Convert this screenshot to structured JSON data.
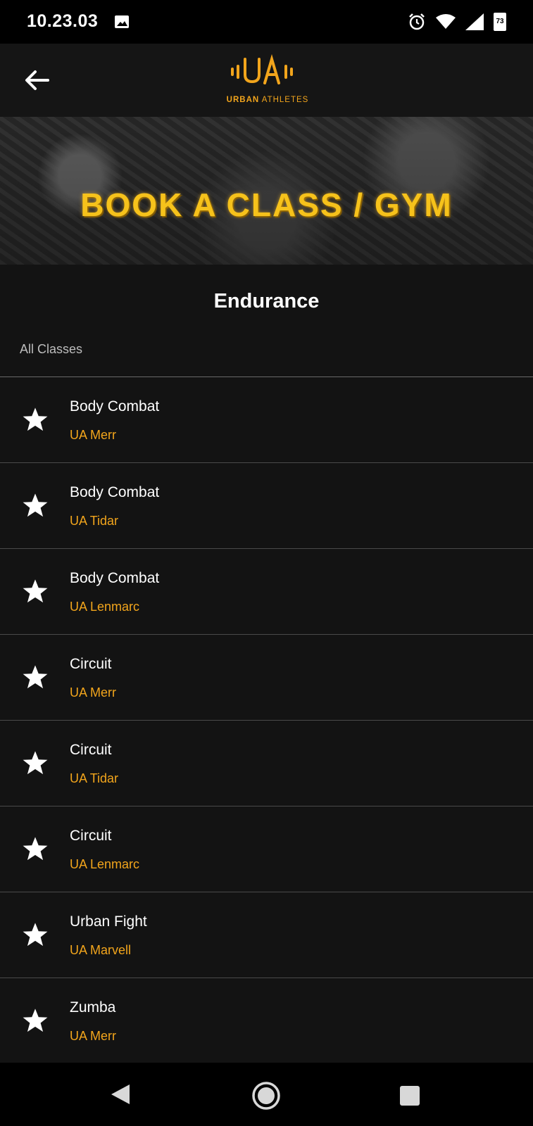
{
  "status_bar": {
    "time": "10.23.03",
    "battery": "73"
  },
  "header": {
    "logo_mark": "UA",
    "logo_text_bold": "URBAN",
    "logo_text_light": "ATHLETES"
  },
  "banner": {
    "title": "BOOK A CLASS / GYM"
  },
  "page": {
    "title": "Endurance",
    "subheader": "All Classes"
  },
  "classes": [
    {
      "name": "Body Combat",
      "location": "UA Merr"
    },
    {
      "name": "Body Combat",
      "location": "UA Tidar"
    },
    {
      "name": "Body Combat",
      "location": "UA Lenmarc"
    },
    {
      "name": "Circuit",
      "location": "UA Merr"
    },
    {
      "name": "Circuit",
      "location": "UA Tidar"
    },
    {
      "name": "Circuit",
      "location": "UA Lenmarc"
    },
    {
      "name": "Urban Fight",
      "location": "UA Marvell"
    },
    {
      "name": "Zumba",
      "location": "UA Merr"
    }
  ],
  "colors": {
    "accent": "#f2a51c",
    "background": "#131313",
    "banner_text": "#f6c21b"
  }
}
